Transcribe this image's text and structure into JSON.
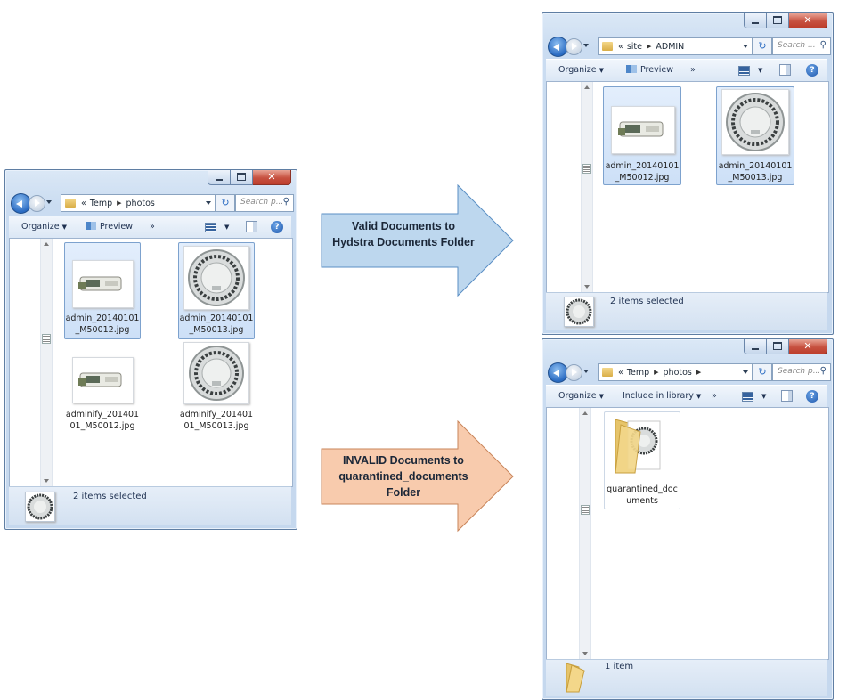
{
  "source_window": {
    "address": {
      "crumbs": [
        "Temp",
        "photos"
      ],
      "chevrons": "«"
    },
    "search_placeholder": "Search p...",
    "toolbar": {
      "organize": "Organize",
      "preview": "Preview",
      "more": "»"
    },
    "items": [
      {
        "label_line1": "admin_20140101",
        "label_line2": "_M50012.jpg",
        "selected": true,
        "thumb": "device-photo"
      },
      {
        "label_line1": "admin_20140101",
        "label_line2": "_M50013.jpg",
        "selected": true,
        "thumb": "round-sensor-photo"
      },
      {
        "label_line1": "adminify_201401",
        "label_line2": "01_M50012.jpg",
        "selected": false,
        "thumb": "device-photo"
      },
      {
        "label_line1": "adminify_201401",
        "label_line2": "01_M50013.jpg",
        "selected": false,
        "thumb": "round-sensor-photo"
      }
    ],
    "status": "2 items selected"
  },
  "valid_window": {
    "address": {
      "crumbs": [
        "site",
        "ADMIN"
      ],
      "chevrons": "«"
    },
    "search_placeholder": "Search ...",
    "toolbar": {
      "organize": "Organize",
      "preview": "Preview",
      "more": "»"
    },
    "items": [
      {
        "label_line1": "admin_20140101",
        "label_line2": "_M50012.jpg",
        "selected": true,
        "thumb": "device-photo"
      },
      {
        "label_line1": "admin_20140101",
        "label_line2": "_M50013.jpg",
        "selected": true,
        "thumb": "round-sensor-photo"
      }
    ],
    "status": "2 items selected"
  },
  "invalid_window": {
    "address": {
      "crumbs": [
        "Temp",
        "photos"
      ],
      "chevrons": "«"
    },
    "search_placeholder": "Search p...",
    "toolbar": {
      "organize": "Organize",
      "include": "Include in library",
      "more": "»"
    },
    "items": [
      {
        "label_line1": "quarantined_doc",
        "label_line2": "uments",
        "selected": false,
        "thumb": "folder-icon"
      }
    ],
    "status": "1 item"
  },
  "arrows": {
    "valid": {
      "line1": "Valid Documents to",
      "line2": "Hydstra Documents Folder",
      "color": "#bdd7ee"
    },
    "invalid": {
      "line1": "INVALID Documents to",
      "line2": "quarantined_documents",
      "line3": "Folder",
      "color": "#f8cbad"
    }
  },
  "colors": {
    "window_frame": "#c5d8ee",
    "selection": "#cde0f7",
    "close_button": "#c75140"
  }
}
